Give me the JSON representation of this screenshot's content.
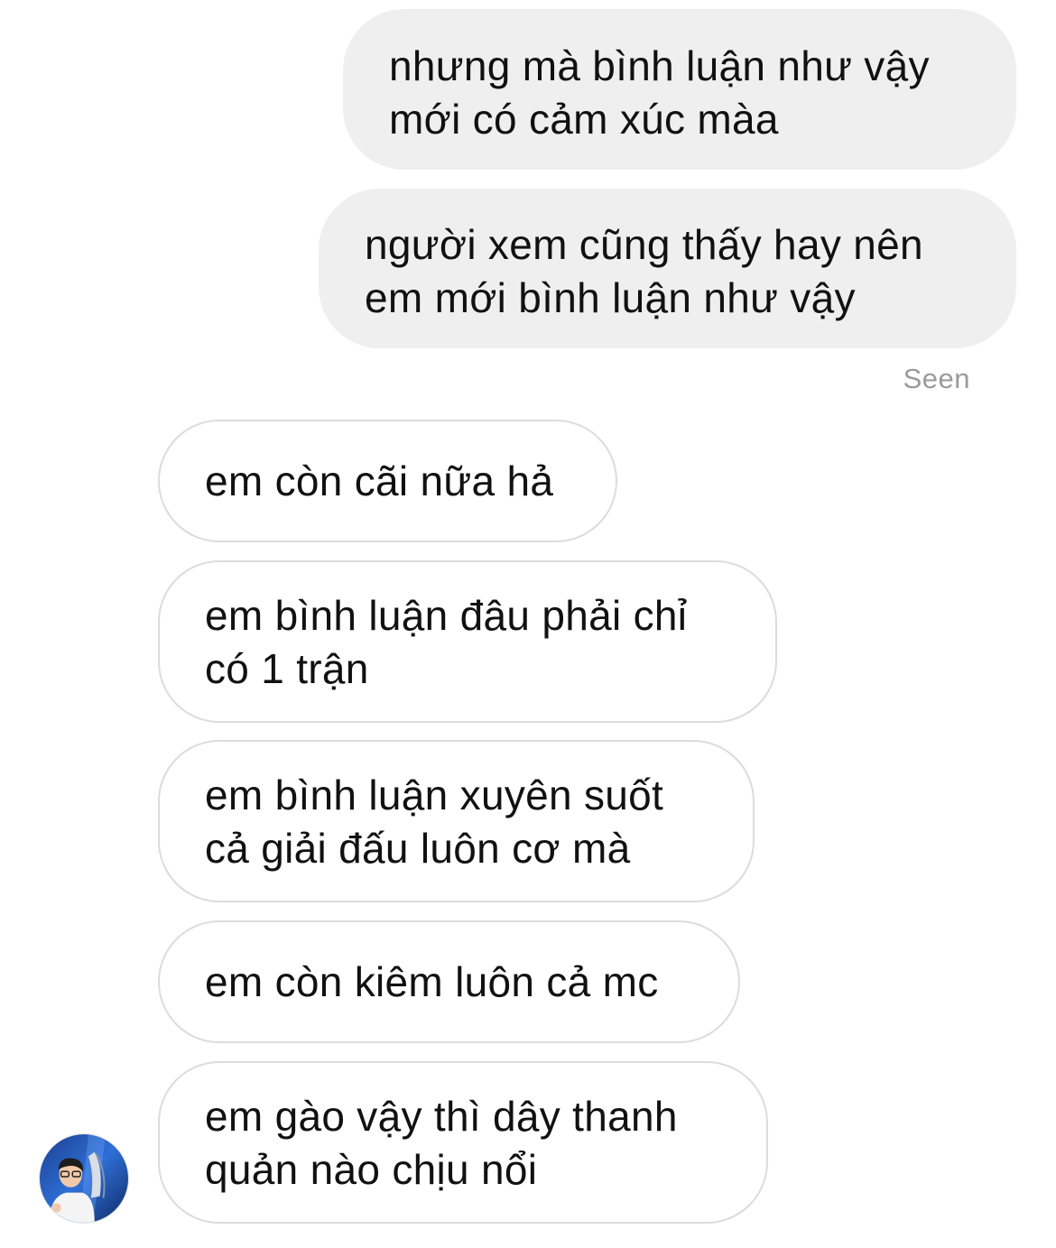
{
  "conversation": {
    "sent": [
      {
        "lines": [
          "nhưng mà bình luận như vậy",
          "mới có cảm xúc màa"
        ]
      },
      {
        "lines": [
          "người xem cũng thấy hay nên",
          "em mới bình luận như vậy"
        ]
      }
    ],
    "status": "Seen",
    "received": [
      {
        "lines": [
          "em còn cãi nữa hả"
        ]
      },
      {
        "lines": [
          "em bình luận đâu phải chỉ",
          "có 1 trận"
        ]
      },
      {
        "lines": [
          "em bình luận xuyên suốt",
          "cả giải đấu luôn cơ mà"
        ]
      },
      {
        "lines": [
          "em còn kiêm luôn cả mc"
        ]
      },
      {
        "lines": [
          "em gào vậy thì dây thanh",
          "quản nào chịu nổi"
        ]
      }
    ]
  },
  "avatar": {
    "icon": "profile-photo"
  },
  "colors": {
    "sent_bubble": "#efefef",
    "received_border": "#dcdcdc",
    "seen_text": "#9b9b9b",
    "text": "#111111"
  }
}
